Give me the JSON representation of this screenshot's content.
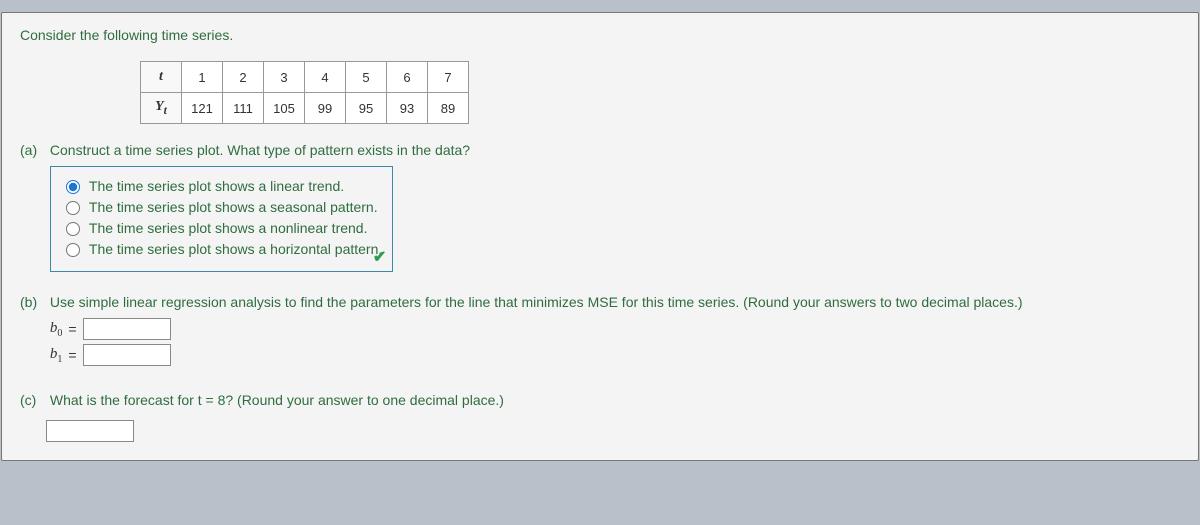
{
  "intro": "Consider the following time series.",
  "table": {
    "row1_header": "t",
    "row2_header": "Yt",
    "t": [
      "1",
      "2",
      "3",
      "4",
      "5",
      "6",
      "7"
    ],
    "y": [
      "121",
      "111",
      "105",
      "99",
      "95",
      "93",
      "89"
    ]
  },
  "parts": {
    "a": {
      "label": "(a)",
      "question": "Construct a time series plot. What type of pattern exists in the data?",
      "options": [
        "The time series plot shows a linear trend.",
        "The time series plot shows a seasonal pattern.",
        "The time series plot shows a nonlinear trend.",
        "The time series plot shows a horizontal pattern."
      ],
      "selected_index": 0,
      "correct_mark": "✔"
    },
    "b": {
      "label": "(b)",
      "question": "Use simple linear regression analysis to find the parameters for the line that minimizes MSE for this time series. (Round your answers to two decimal places.)",
      "b0_symbol": "b",
      "b0_sub": "0",
      "b1_symbol": "b",
      "b1_sub": "1",
      "equals": "=",
      "b0_value": "",
      "b1_value": ""
    },
    "c": {
      "label": "(c)",
      "question": "What is the forecast for t = 8? (Round your answer to one decimal place.)",
      "value": ""
    }
  },
  "chart_data": {
    "type": "table",
    "title": "Time series t vs Yt",
    "categories": [
      "1",
      "2",
      "3",
      "4",
      "5",
      "6",
      "7"
    ],
    "values": [
      121,
      111,
      105,
      99,
      95,
      93,
      89
    ],
    "xlabel": "t",
    "ylabel": "Yt"
  }
}
